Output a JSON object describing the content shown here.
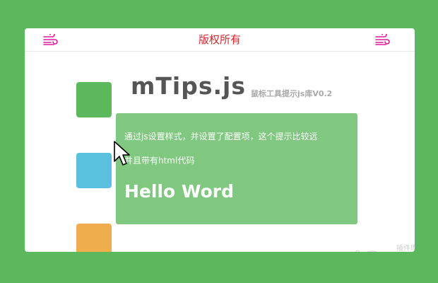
{
  "topbar": {
    "title": "版权所有",
    "left_icon": "wind-icon",
    "right_icon": "wind-icon",
    "icon_color": "#e0189e"
  },
  "squares": [
    {
      "color": "#5cb85c"
    },
    {
      "color": "#5bc0de"
    },
    {
      "color": "#f0ad4e"
    }
  ],
  "brand": {
    "name": "mTips.js",
    "subtitle": "鼠标工具提示js库V0.2"
  },
  "tooltip": {
    "line1": "通过js设置样式，并设置了配置项，这个提示比较远",
    "line2": "并且带有html代码",
    "heading": "Hello Word"
  },
  "watermark": {
    "text": "jQuery",
    "subtext": "插件库",
    "icon": "watermark-logo"
  },
  "colors": {
    "background": "#5cb85c",
    "title": "#d9262d",
    "tooltip_bg": "#80c880"
  }
}
